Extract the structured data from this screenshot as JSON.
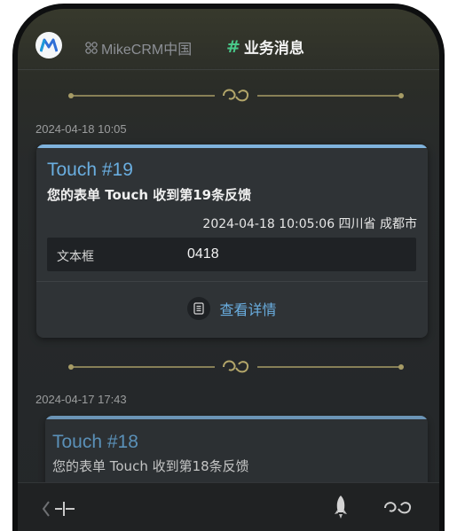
{
  "header": {
    "brand": "MikeCRM中国",
    "channel_hash": "#",
    "channel": "业务消息"
  },
  "messages": [
    {
      "timestamp": "2024-04-18 10:05",
      "title": "Touch #19",
      "subtitle": "您的表单 Touch 收到第19条反馈",
      "meta": "2024-04-18 10:05:06  四川省 成都市",
      "field_label": "文本框",
      "field_value": "0418",
      "detail_label": "查看详情"
    },
    {
      "timestamp": "2024-04-17 17:43",
      "title": "Touch #18",
      "subtitle": "您的表单 Touch 收到第18条反馈"
    }
  ],
  "colors": {
    "accent": "#6aaee0",
    "channel_hash": "#49c98a",
    "card_bg": "#2f3336",
    "divider": "#b3a66a"
  },
  "icons": {
    "app_logo": "mikecrm-logo-icon",
    "brand": "clover-grid-icon",
    "divider": "swirl-ornament-icon",
    "detail": "document-list-icon",
    "back": "chevron-left-icon",
    "crosshair": "crosshair-icon",
    "rocket": "rocket-icon",
    "swirl": "swirl-icon"
  }
}
